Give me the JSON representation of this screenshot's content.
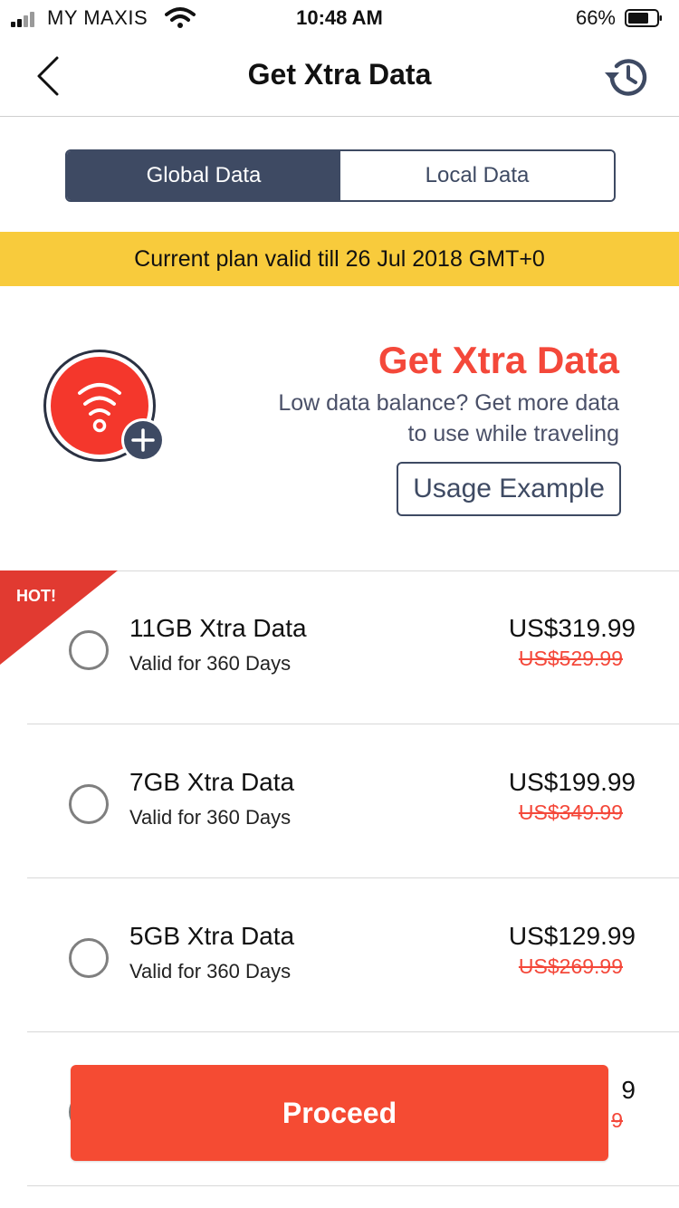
{
  "status_bar": {
    "carrier": "MY MAXIS",
    "time": "10:48 AM",
    "battery": "66%"
  },
  "header": {
    "title": "Get Xtra Data",
    "back_icon": "chevron-left-icon",
    "history_icon": "history-icon"
  },
  "tabs": [
    {
      "label": "Global Data",
      "active": true
    },
    {
      "label": "Local Data",
      "active": false
    }
  ],
  "banner": {
    "text": "Current plan valid till 26 Jul 2018 GMT+0"
  },
  "promo": {
    "title": "Get Xtra Data",
    "description_line1": "Low data balance? Get more data",
    "description_line2": "to use while traveling",
    "usage_button": "Usage Example",
    "icon": "wifi-plus-icon"
  },
  "plans": [
    {
      "name": "11GB Xtra Data",
      "validity": "Valid for 360 Days",
      "price": "US$319.99",
      "old_price": "US$529.99",
      "badge": "HOT!"
    },
    {
      "name": "7GB Xtra Data",
      "validity": "Valid for 360 Days",
      "price": "US$199.99",
      "old_price": "US$349.99"
    },
    {
      "name": "5GB Xtra Data",
      "validity": "Valid for 360 Days",
      "price": "US$129.99",
      "old_price": "US$269.99"
    }
  ],
  "partial_plan": {
    "price_tail": "9",
    "old_price_tail": "9"
  },
  "proceed": {
    "label": "Proceed"
  },
  "colors": {
    "accent": "#f4483a",
    "navy": "#3e4a63",
    "banner": "#f8cb3c",
    "proceed": "#f54b33"
  }
}
